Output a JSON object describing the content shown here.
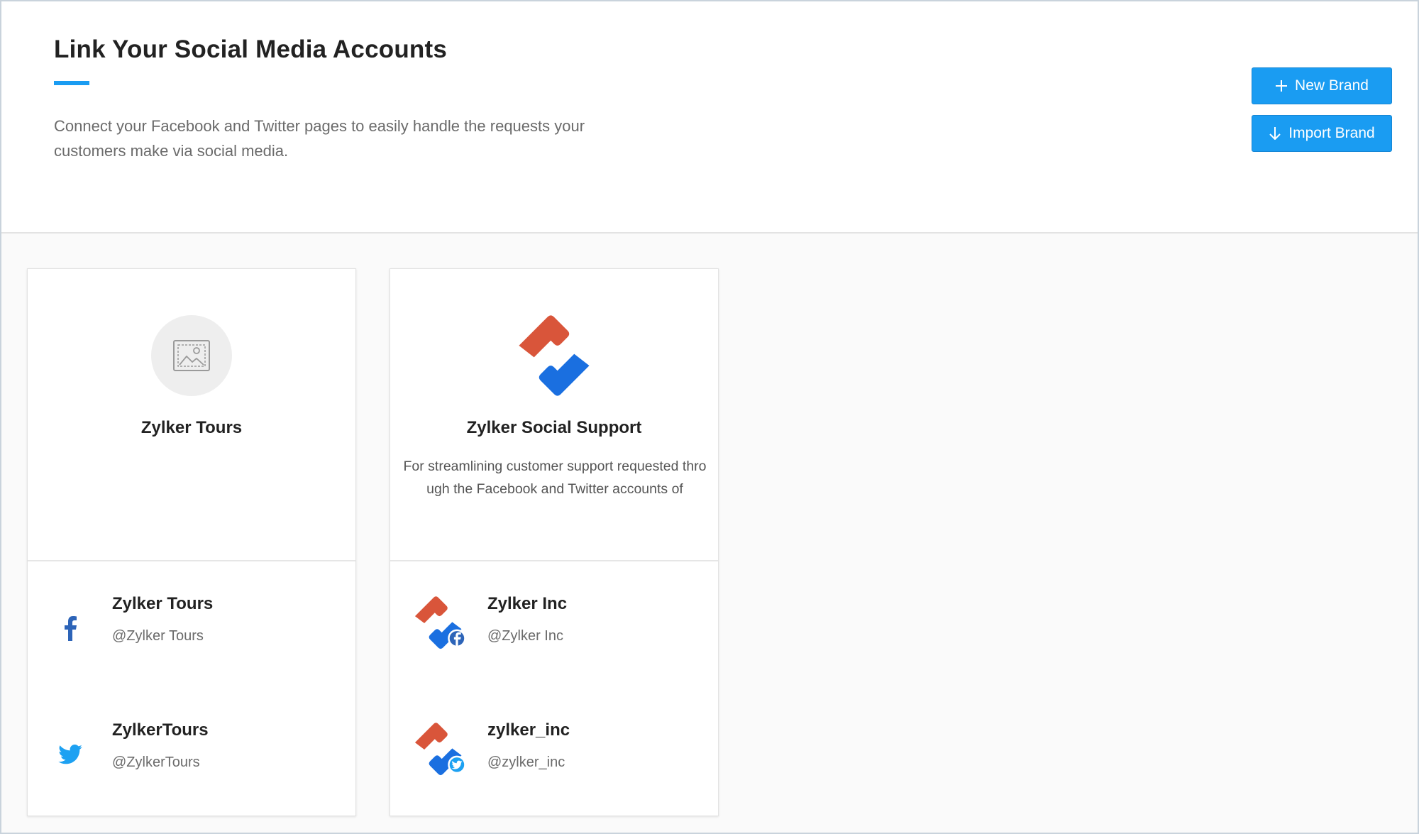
{
  "header": {
    "title": "Link Your Social Media Accounts",
    "description": "Connect your Facebook and Twitter pages to easily handle the requests your customers make via social media.",
    "new_brand_label": "New Brand",
    "import_brand_label": "Import Brand",
    "accent_color": "#1a9cf2"
  },
  "brands": [
    {
      "name": "Zylker Tours",
      "description": "",
      "logo": "image-placeholder-icon",
      "accounts": [
        {
          "network": "facebook",
          "icon": "facebook-icon",
          "name": "Zylker Tours",
          "handle": "@Zylker Tours"
        },
        {
          "network": "twitter",
          "icon": "twitter-icon",
          "name": "ZylkerTours",
          "handle": "@ZylkerTours"
        }
      ]
    },
    {
      "name": "Zylker Social Support",
      "description": "For streamlining customer support requested through the Facebook and Twitter accounts of",
      "logo": "zylker-logo-icon",
      "accounts": [
        {
          "network": "facebook",
          "icon": "zylker-facebook-icon",
          "name": "Zylker Inc",
          "handle": "@Zylker Inc"
        },
        {
          "network": "twitter",
          "icon": "zylker-twitter-icon",
          "name": "zylker_inc",
          "handle": "@zylker_inc"
        }
      ]
    }
  ],
  "colors": {
    "logo_red": "#d9553a",
    "logo_blue": "#1a6fe0",
    "facebook_blue": "#2d64b8",
    "twitter_blue": "#1da1f2"
  }
}
